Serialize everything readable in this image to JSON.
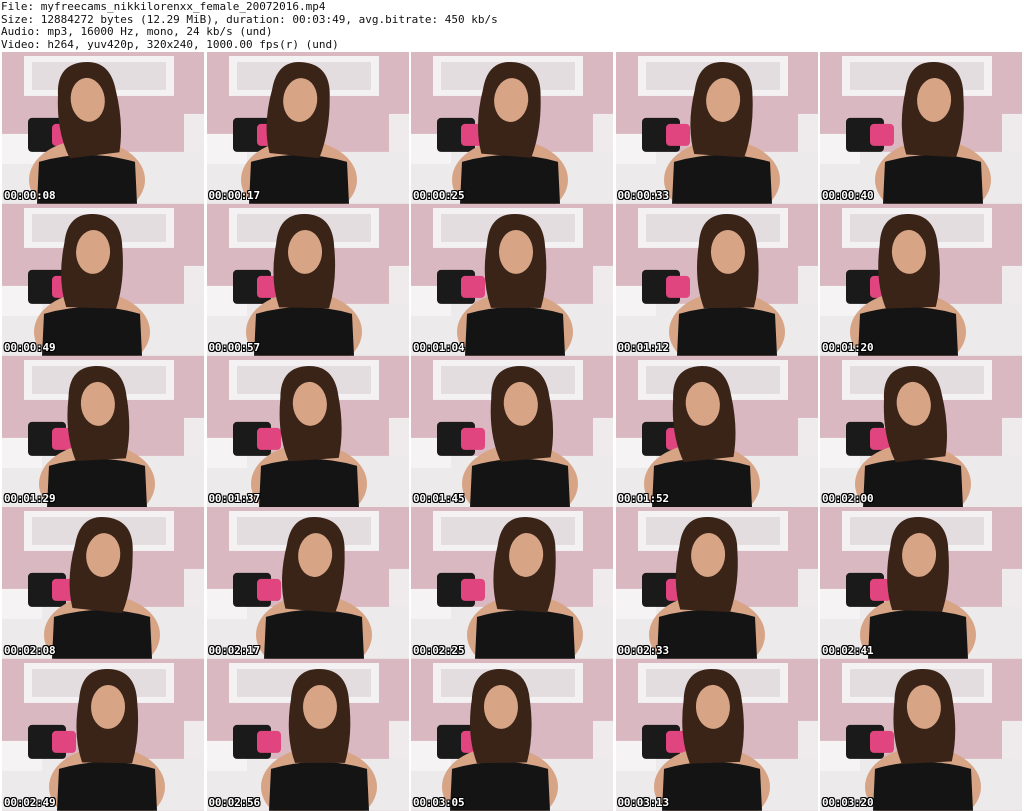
{
  "header": {
    "file_line": "File: myfreecams_nikkilorenxx_female_20072016.mp4",
    "size_line": "Size: 12884272 bytes (12.29 MiB), duration: 00:03:49, avg.bitrate: 450 kb/s",
    "audio_line": "Audio: mp3, 16000 Hz, mono, 24 kb/s (und)",
    "video_line": "Video: h264, yuv420p, 320x240, 1000.00 fps(r) (und)"
  },
  "thumbnails": [
    {
      "timestamp": "00:00:08"
    },
    {
      "timestamp": "00:00:17"
    },
    {
      "timestamp": "00:00:25"
    },
    {
      "timestamp": "00:00:33"
    },
    {
      "timestamp": "00:00:40"
    },
    {
      "timestamp": "00:00:49"
    },
    {
      "timestamp": "00:00:57"
    },
    {
      "timestamp": "00:01:04"
    },
    {
      "timestamp": "00:01:12"
    },
    {
      "timestamp": "00:01:20"
    },
    {
      "timestamp": "00:01:29"
    },
    {
      "timestamp": "00:01:37"
    },
    {
      "timestamp": "00:01:45"
    },
    {
      "timestamp": "00:01:52"
    },
    {
      "timestamp": "00:02:00"
    },
    {
      "timestamp": "00:02:08"
    },
    {
      "timestamp": "00:02:17"
    },
    {
      "timestamp": "00:02:25"
    },
    {
      "timestamp": "00:02:33"
    },
    {
      "timestamp": "00:02:41"
    },
    {
      "timestamp": "00:02:49"
    },
    {
      "timestamp": "00:02:56"
    },
    {
      "timestamp": "00:03:05"
    },
    {
      "timestamp": "00:03:13"
    },
    {
      "timestamp": "00:03:20"
    }
  ],
  "colors": {
    "wall": "#d9b8c1",
    "mirror_frame": "#f4f1f3",
    "bed": "#eceaea",
    "pillow_black": "#1a1a1a",
    "pillow_pink": "#e0457f",
    "hair": "#3a2418",
    "skin": "#d7a486",
    "top": "#141414"
  }
}
